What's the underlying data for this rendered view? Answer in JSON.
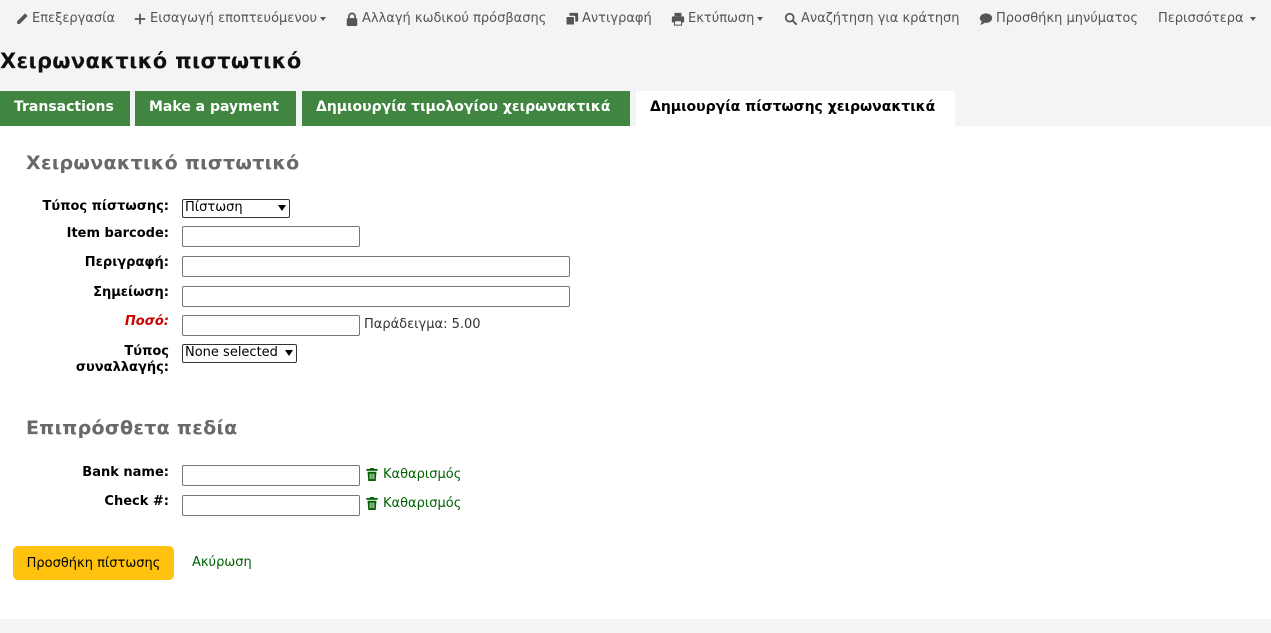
{
  "toolbar": {
    "edit": "Επεξεργασία",
    "add_guarantor": "Εισαγωγή εποπτευόμενου",
    "change_password": "Αλλαγή κωδικού πρόσβασης",
    "duplicate": "Αντιγραφή",
    "print": "Εκτύπωση",
    "search_hold": "Αναζήτηση για κράτηση",
    "add_message": "Προσθήκη μηνύματος",
    "more": "Περισσότερα"
  },
  "page_title": "Χειρωνακτικό πιστωτικό",
  "tabs": [
    {
      "label": "Transactions"
    },
    {
      "label": "Make a payment"
    },
    {
      "label": "Δημιουργία τιμολογίου χειρωνακτικά"
    },
    {
      "label": "Δημιουργία πίστωσης χειρωνακτικά",
      "active": true
    }
  ],
  "form": {
    "section_title": "Χειρωνακτικό πιστωτικό",
    "credit_type_label": "Τύπος πίστωσης:",
    "credit_type_value": "Πίστωση",
    "barcode_label": "Item barcode:",
    "barcode_value": "",
    "description_label": "Περιγραφή:",
    "description_value": "",
    "note_label": "Σημείωση:",
    "note_value": "",
    "amount_label": "Ποσό:",
    "amount_value": "",
    "amount_hint": "Παράδειγμα: 5.00",
    "transaction_type_label_line1": "Τύπος",
    "transaction_type_label_line2": "συναλλαγής:",
    "transaction_type_value": "None selected"
  },
  "extra": {
    "section_title": "Επιπρόσθετα πεδία",
    "bank_label": "Bank name:",
    "bank_value": "",
    "check_label": "Check #:",
    "check_value": "",
    "clear_label": "Καθαρισμός"
  },
  "actions": {
    "submit": "Προσθήκη πίστωσης",
    "cancel": "Ακύρωση"
  },
  "colors": {
    "tab_green": "#408540",
    "link_green": "#006100",
    "button_yellow": "#ffc20e",
    "required_red": "#cc0000"
  }
}
